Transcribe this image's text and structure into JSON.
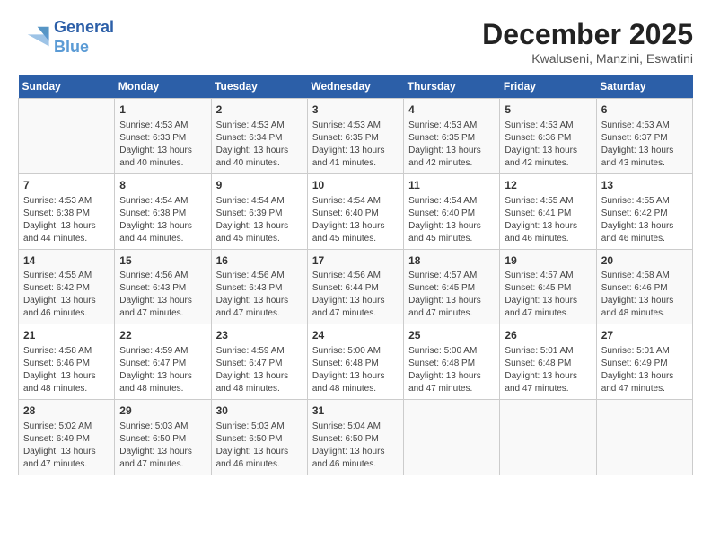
{
  "header": {
    "logo_line1": "General",
    "logo_line2": "Blue",
    "month": "December 2025",
    "location": "Kwaluseni, Manzini, Eswatini"
  },
  "days_of_week": [
    "Sunday",
    "Monday",
    "Tuesday",
    "Wednesday",
    "Thursday",
    "Friday",
    "Saturday"
  ],
  "weeks": [
    [
      {
        "day": "",
        "content": ""
      },
      {
        "day": "1",
        "content": "Sunrise: 4:53 AM\nSunset: 6:33 PM\nDaylight: 13 hours\nand 40 minutes."
      },
      {
        "day": "2",
        "content": "Sunrise: 4:53 AM\nSunset: 6:34 PM\nDaylight: 13 hours\nand 40 minutes."
      },
      {
        "day": "3",
        "content": "Sunrise: 4:53 AM\nSunset: 6:35 PM\nDaylight: 13 hours\nand 41 minutes."
      },
      {
        "day": "4",
        "content": "Sunrise: 4:53 AM\nSunset: 6:35 PM\nDaylight: 13 hours\nand 42 minutes."
      },
      {
        "day": "5",
        "content": "Sunrise: 4:53 AM\nSunset: 6:36 PM\nDaylight: 13 hours\nand 42 minutes."
      },
      {
        "day": "6",
        "content": "Sunrise: 4:53 AM\nSunset: 6:37 PM\nDaylight: 13 hours\nand 43 minutes."
      }
    ],
    [
      {
        "day": "7",
        "content": "Sunrise: 4:53 AM\nSunset: 6:38 PM\nDaylight: 13 hours\nand 44 minutes."
      },
      {
        "day": "8",
        "content": "Sunrise: 4:54 AM\nSunset: 6:38 PM\nDaylight: 13 hours\nand 44 minutes."
      },
      {
        "day": "9",
        "content": "Sunrise: 4:54 AM\nSunset: 6:39 PM\nDaylight: 13 hours\nand 45 minutes."
      },
      {
        "day": "10",
        "content": "Sunrise: 4:54 AM\nSunset: 6:40 PM\nDaylight: 13 hours\nand 45 minutes."
      },
      {
        "day": "11",
        "content": "Sunrise: 4:54 AM\nSunset: 6:40 PM\nDaylight: 13 hours\nand 45 minutes."
      },
      {
        "day": "12",
        "content": "Sunrise: 4:55 AM\nSunset: 6:41 PM\nDaylight: 13 hours\nand 46 minutes."
      },
      {
        "day": "13",
        "content": "Sunrise: 4:55 AM\nSunset: 6:42 PM\nDaylight: 13 hours\nand 46 minutes."
      }
    ],
    [
      {
        "day": "14",
        "content": "Sunrise: 4:55 AM\nSunset: 6:42 PM\nDaylight: 13 hours\nand 46 minutes."
      },
      {
        "day": "15",
        "content": "Sunrise: 4:56 AM\nSunset: 6:43 PM\nDaylight: 13 hours\nand 47 minutes."
      },
      {
        "day": "16",
        "content": "Sunrise: 4:56 AM\nSunset: 6:43 PM\nDaylight: 13 hours\nand 47 minutes."
      },
      {
        "day": "17",
        "content": "Sunrise: 4:56 AM\nSunset: 6:44 PM\nDaylight: 13 hours\nand 47 minutes."
      },
      {
        "day": "18",
        "content": "Sunrise: 4:57 AM\nSunset: 6:45 PM\nDaylight: 13 hours\nand 47 minutes."
      },
      {
        "day": "19",
        "content": "Sunrise: 4:57 AM\nSunset: 6:45 PM\nDaylight: 13 hours\nand 47 minutes."
      },
      {
        "day": "20",
        "content": "Sunrise: 4:58 AM\nSunset: 6:46 PM\nDaylight: 13 hours\nand 48 minutes."
      }
    ],
    [
      {
        "day": "21",
        "content": "Sunrise: 4:58 AM\nSunset: 6:46 PM\nDaylight: 13 hours\nand 48 minutes."
      },
      {
        "day": "22",
        "content": "Sunrise: 4:59 AM\nSunset: 6:47 PM\nDaylight: 13 hours\nand 48 minutes."
      },
      {
        "day": "23",
        "content": "Sunrise: 4:59 AM\nSunset: 6:47 PM\nDaylight: 13 hours\nand 48 minutes."
      },
      {
        "day": "24",
        "content": "Sunrise: 5:00 AM\nSunset: 6:48 PM\nDaylight: 13 hours\nand 48 minutes."
      },
      {
        "day": "25",
        "content": "Sunrise: 5:00 AM\nSunset: 6:48 PM\nDaylight: 13 hours\nand 47 minutes."
      },
      {
        "day": "26",
        "content": "Sunrise: 5:01 AM\nSunset: 6:48 PM\nDaylight: 13 hours\nand 47 minutes."
      },
      {
        "day": "27",
        "content": "Sunrise: 5:01 AM\nSunset: 6:49 PM\nDaylight: 13 hours\nand 47 minutes."
      }
    ],
    [
      {
        "day": "28",
        "content": "Sunrise: 5:02 AM\nSunset: 6:49 PM\nDaylight: 13 hours\nand 47 minutes."
      },
      {
        "day": "29",
        "content": "Sunrise: 5:03 AM\nSunset: 6:50 PM\nDaylight: 13 hours\nand 47 minutes."
      },
      {
        "day": "30",
        "content": "Sunrise: 5:03 AM\nSunset: 6:50 PM\nDaylight: 13 hours\nand 46 minutes."
      },
      {
        "day": "31",
        "content": "Sunrise: 5:04 AM\nSunset: 6:50 PM\nDaylight: 13 hours\nand 46 minutes."
      },
      {
        "day": "",
        "content": ""
      },
      {
        "day": "",
        "content": ""
      },
      {
        "day": "",
        "content": ""
      }
    ]
  ]
}
